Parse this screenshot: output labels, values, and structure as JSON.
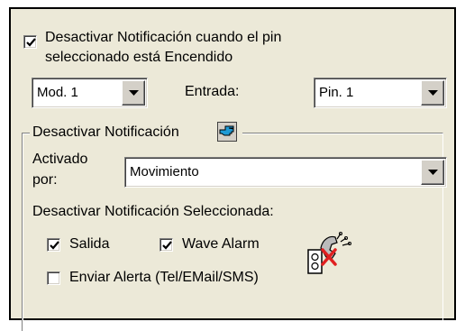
{
  "top_checkbox": {
    "checked": true,
    "label_line1": "Desactivar Notificación cuando el pin",
    "label_line2": "seleccionado está Encendido"
  },
  "module_select": {
    "value": "Mod. 1"
  },
  "input_label": "Entrada:",
  "pin_select": {
    "value": "Pin. 1"
  },
  "group": {
    "title": "Desactivar Notificación",
    "icon": "hand-pointer-icon"
  },
  "activated_by": {
    "label_line1": "Activado",
    "label_line2": "por:",
    "value": "Movimiento"
  },
  "selected_section_label": "Desactivar Notificación Seleccionada:",
  "options": {
    "output": {
      "label": "Salida",
      "checked": true
    },
    "wave_alarm": {
      "label": "Wave Alarm",
      "checked": true
    },
    "send_alert": {
      "label": "Enviar Alerta (Tel/EMail/SMS)",
      "checked": false
    }
  },
  "status_icon": "disabled-phone-alert-icon",
  "colors": {
    "panel_bg": "#ece9d8",
    "field_bg": "#ffffff",
    "icon_blue": "#1f9bd6",
    "disabled_x": "#e02020"
  }
}
